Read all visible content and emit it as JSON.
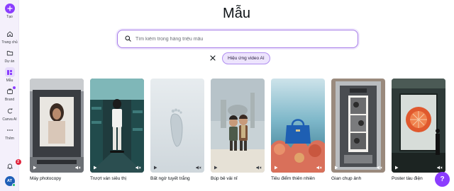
{
  "sidebar": {
    "create_label": "Tạo",
    "items": [
      {
        "label": "Trang chủ",
        "icon": "home-icon"
      },
      {
        "label": "Dự án",
        "icon": "folder-icon"
      },
      {
        "label": "Mẫu",
        "icon": "templates-icon"
      },
      {
        "label": "Brand",
        "icon": "brand-icon"
      },
      {
        "label": "Canva AI",
        "icon": "canva-ai-icon"
      },
      {
        "label": "Thêm",
        "icon": "more-icon"
      }
    ],
    "notification_count": "2",
    "avatar_initials": "AT"
  },
  "page": {
    "title": "Mẫu"
  },
  "search": {
    "placeholder": "Tìm kiếm trong hàng triệu mẫu",
    "value": ""
  },
  "filter": {
    "chip_label": "Hiệu ứng video AI"
  },
  "cards": [
    {
      "label": "Máy photocopy"
    },
    {
      "label": "Trượt ván siêu thị"
    },
    {
      "label": "Bất ngờ tuyết trắng"
    },
    {
      "label": "Búp bê vải nỉ"
    },
    {
      "label": "Tiêu điểm thiên nhiên"
    },
    {
      "label": "Gian chụp ảnh"
    },
    {
      "label": "Poster tàu điện"
    }
  ],
  "help": {
    "label": "?"
  },
  "colors": {
    "accent": "#8b3dff",
    "sidebar_bg": "#f4f0fb",
    "badge": "#e0223b"
  }
}
